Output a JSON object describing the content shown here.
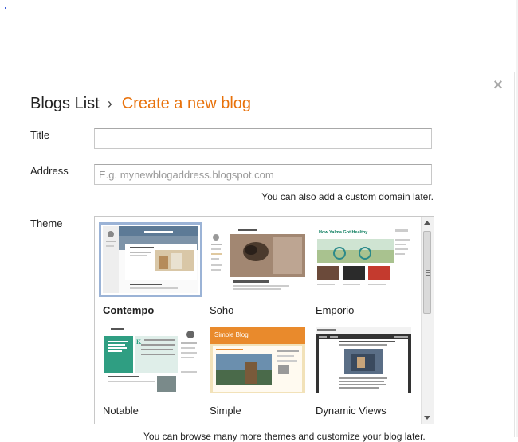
{
  "dialog": {
    "close_symbol": "×",
    "breadcrumb": {
      "parent": "Blogs List",
      "separator": "›",
      "current": "Create a new blog"
    }
  },
  "form": {
    "title_label": "Title",
    "title_value": "",
    "address_label": "Address",
    "address_value": "",
    "address_placeholder": "E.g. mynewblogaddress.blogspot.com",
    "address_hint": "You can also add a custom domain later.",
    "theme_label": "Theme"
  },
  "themes": [
    {
      "name": "Contempo",
      "selected": true
    },
    {
      "name": "Soho",
      "selected": false
    },
    {
      "name": "Emporio",
      "selected": false
    },
    {
      "name": "Notable",
      "selected": false
    },
    {
      "name": "Simple",
      "selected": false
    },
    {
      "name": "Dynamic Views",
      "selected": false
    }
  ],
  "thumbnails": {
    "emporio_title": "How Yalma Got Healthy",
    "simple_title": "Simple Blog",
    "notable_title": "Notable"
  },
  "footer_text": "You can browse many more themes and customize your blog later.",
  "colors": {
    "accent": "#e8710a",
    "selected_outline": "#9bb3d6",
    "notable_green": "#2f9e82"
  }
}
